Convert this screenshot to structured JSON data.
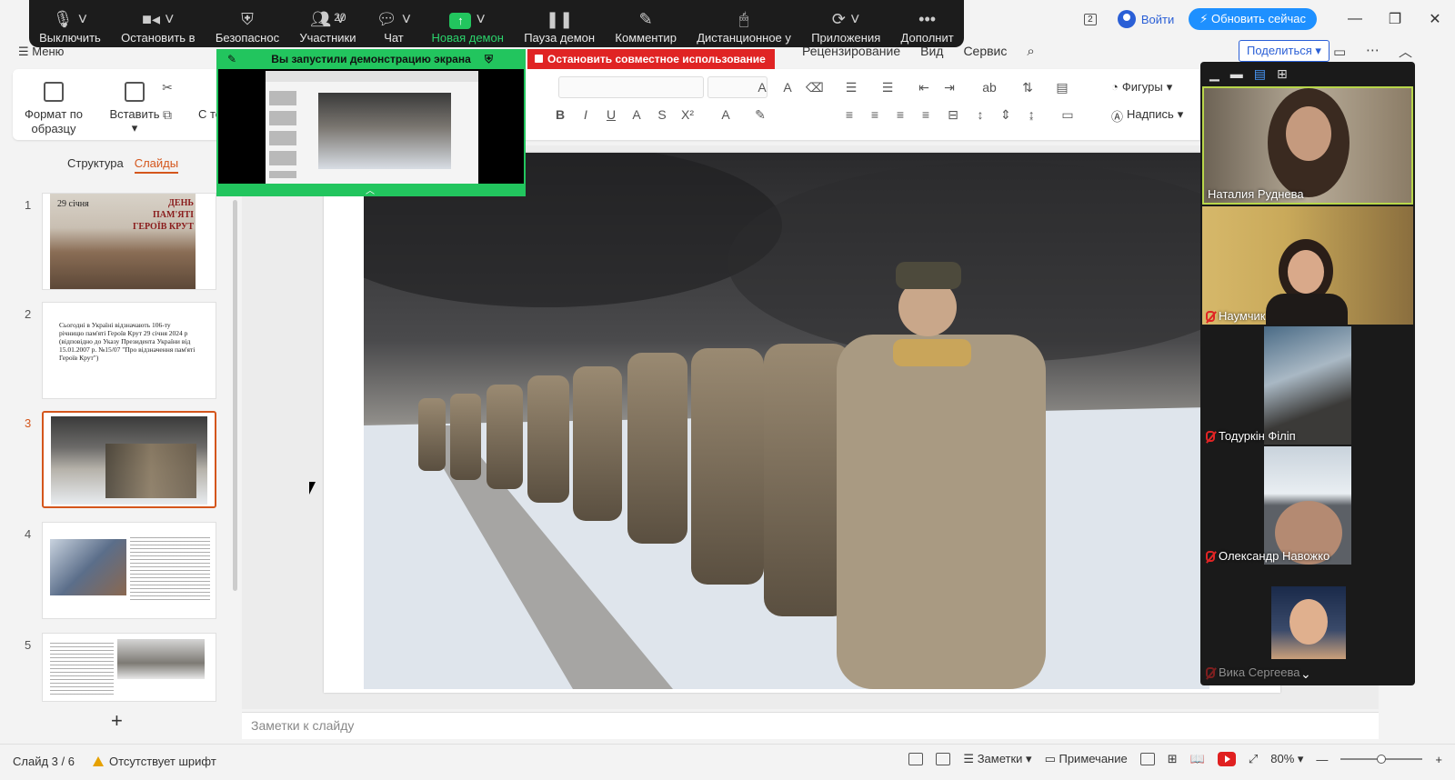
{
  "titlebar": {
    "window_badge": "2",
    "login_label": "Войти",
    "update_label": "⚡ Обновить сейчас"
  },
  "menu": {
    "menu_label": "Меню",
    "tabs": [
      "Рецензирование",
      "Вид",
      "Сервис"
    ],
    "share_label": "Поделиться"
  },
  "ribbon": {
    "format_painter": "Формат по образцу",
    "paste": "Вставить",
    "text_partial": "С те",
    "shapes": "Фигуры",
    "textbox": "Надпись"
  },
  "slides_pane": {
    "tab_structure": "Структура",
    "tab_slides": "Слайды",
    "slides": [
      {
        "num": "1",
        "title_a": "29 січня",
        "title_b": "ДЕНЬ ПАМ'ЯТІ ГЕРОЇВ КРУТ"
      },
      {
        "num": "2",
        "text": "Сьогодні в Україні відзначають 106-ту річницю пам'яті Героїв Крут 29 січня 2024 р (відповідно до Указу Президента України від 15.01.2007 р. №15/07 \"Про відзначення пам'яті Героїв Крут\")"
      },
      {
        "num": "3"
      },
      {
        "num": "4"
      },
      {
        "num": "5"
      }
    ],
    "add_label": "+"
  },
  "notes_placeholder": "Заметки к слайду",
  "status": {
    "slide_counter": "Слайд 3 / 6",
    "font_warning": "Отсутствует шрифт",
    "notes_label": "Заметки",
    "comment_label": "Примечание",
    "zoom_level": "80%"
  },
  "zoom_toolbar": {
    "items": [
      {
        "label": "Выключить",
        "icon": "mic-icon"
      },
      {
        "label": "Остановить в",
        "icon": "video-icon"
      },
      {
        "label": "Безопаснос",
        "icon": "shield-icon"
      },
      {
        "label": "Участники",
        "icon": "participants-icon",
        "count": "20"
      },
      {
        "label": "Чат",
        "icon": "chat-icon"
      },
      {
        "label": "Новая демон",
        "icon": "share-screen-icon"
      },
      {
        "label": "Пауза демон",
        "icon": "pause-icon"
      },
      {
        "label": "Комментир",
        "icon": "annotate-icon"
      },
      {
        "label": "Дистанционное у",
        "icon": "remote-control-icon"
      },
      {
        "label": "Приложения",
        "icon": "apps-icon"
      },
      {
        "label": "Дополнит",
        "icon": "more-icon"
      }
    ],
    "share_banner": "Вы запустили демонстрацию экрана",
    "stop_share": "Остановить совместное использование"
  },
  "gallery": {
    "participants": [
      {
        "name": "Наталия Руднева",
        "muted": false,
        "active": true
      },
      {
        "name": "Наумчик",
        "muted": true,
        "active": false
      },
      {
        "name": "Тодуркін Філіп",
        "muted": true,
        "active": false
      },
      {
        "name": "Олександр Навожко",
        "muted": true,
        "active": false
      },
      {
        "name": "Вика Сергеева",
        "muted": true,
        "active": false
      }
    ]
  },
  "colors": {
    "accent_orange": "#d4561c",
    "zoom_green": "#22c55e",
    "zoom_red": "#e02424",
    "link_blue": "#2a5fd6"
  }
}
